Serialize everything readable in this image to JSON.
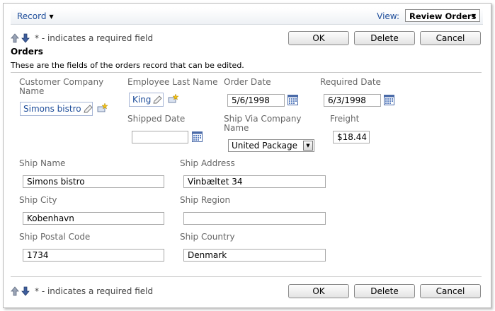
{
  "toolbar": {
    "menu_label": "Record",
    "view_label": "View:",
    "view_value": "Review Orders"
  },
  "required_note": "* - indicates a required field",
  "buttons": {
    "ok": "OK",
    "delete": "Delete",
    "cancel": "Cancel"
  },
  "section": {
    "title": "Orders",
    "description": "These are the fields of the orders record that can be edited."
  },
  "fields": {
    "customer_company_name": {
      "label_line1": "Customer Company",
      "label_line2": "Name",
      "value": "Simons bistro"
    },
    "employee_last_name": {
      "label": "Employee Last Name",
      "value": "King"
    },
    "order_date": {
      "label": "Order Date",
      "value": "5/6/1998"
    },
    "required_date": {
      "label": "Required Date",
      "value": "6/3/1998"
    },
    "shipped_date": {
      "label": "Shipped Date",
      "value": ""
    },
    "ship_via": {
      "label_line1": "Ship Via Company",
      "label_line2": "Name",
      "value": "United Package"
    },
    "freight": {
      "label": "Freight",
      "value": "$18.44"
    },
    "ship_name": {
      "label": "Ship Name",
      "value": "Simons bistro"
    },
    "ship_address": {
      "label": "Ship Address",
      "value": "Vinbæltet 34"
    },
    "ship_city": {
      "label": "Ship City",
      "value": "Kobenhavn"
    },
    "ship_region": {
      "label": "Ship Region",
      "value": ""
    },
    "ship_postal_code": {
      "label": "Ship Postal Code",
      "value": "1734"
    },
    "ship_country": {
      "label": "Ship Country",
      "value": "Denmark"
    }
  },
  "icons": {
    "up": "arrow-up-icon",
    "down": "arrow-down-icon",
    "pencil": "pencil-icon",
    "new": "new-item-icon",
    "calendar": "calendar-icon",
    "dropdown": "chevron-down-icon"
  },
  "colors": {
    "link": "#1f4e9b",
    "label": "#666666",
    "border": "#a9a9a9"
  }
}
